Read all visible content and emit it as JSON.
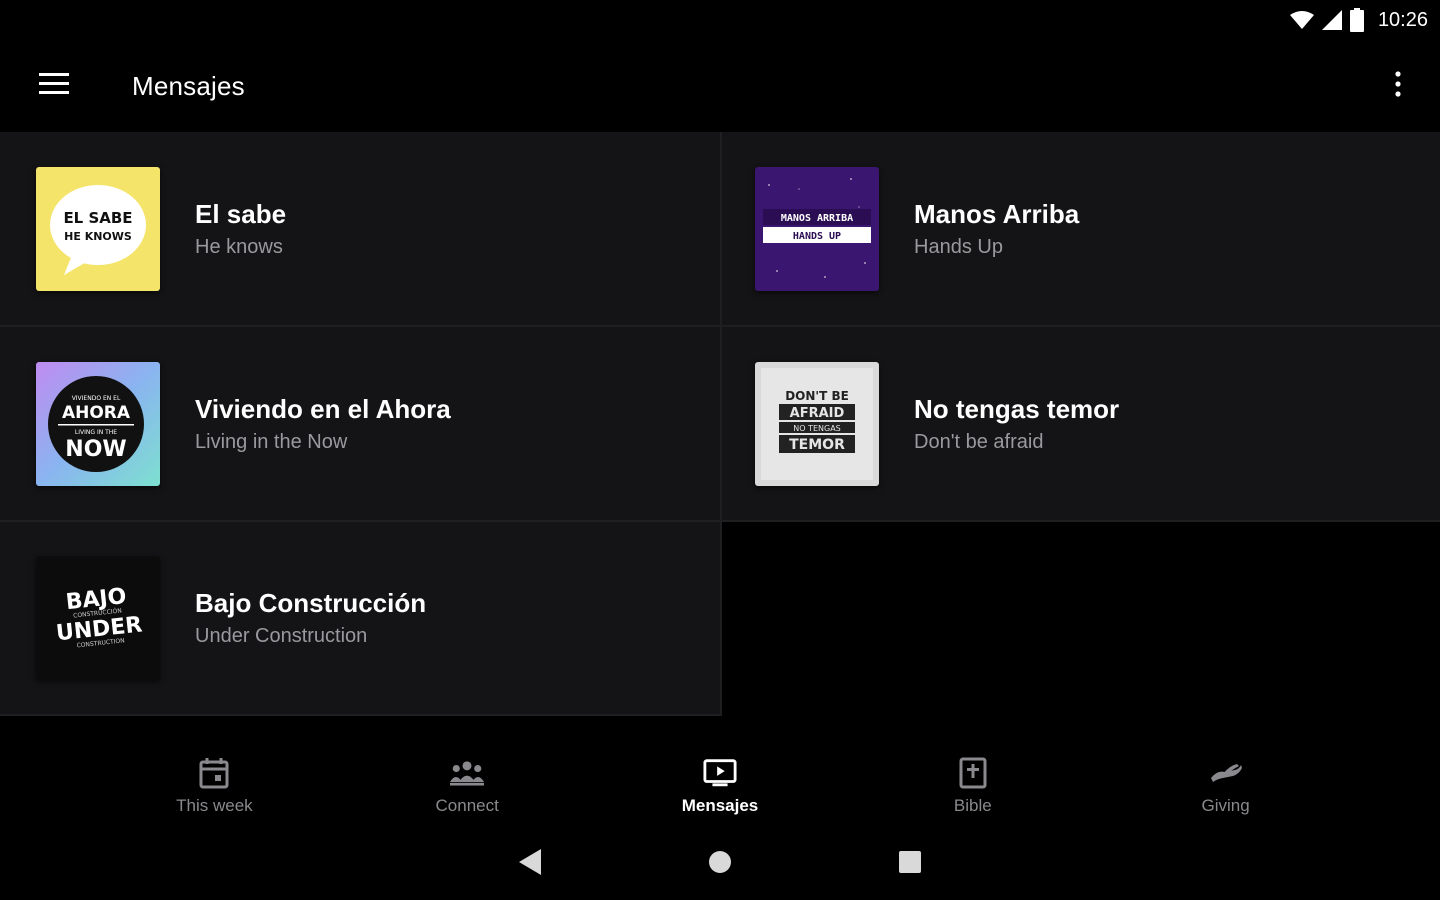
{
  "status_bar": {
    "time": "10:26",
    "icons": [
      "wifi-icon",
      "cell-signal-icon",
      "battery-icon"
    ]
  },
  "app_bar": {
    "title": "Mensajes",
    "menu_icon": "hamburger-menu-icon",
    "overflow_icon": "more-vert-icon"
  },
  "messages": [
    {
      "title": "El sabe",
      "subtitle": "He knows",
      "art": {
        "line1": "EL SABE",
        "line2": "HE KNOWS"
      }
    },
    {
      "title": "Manos Arriba",
      "subtitle": "Hands Up",
      "art": {
        "line1": "MANOS ARRIBA",
        "line2": "HANDS UP"
      }
    },
    {
      "title": "Viviendo en el Ahora",
      "subtitle": "Living in the Now",
      "art": {
        "line1": "VIVIENDO EN EL",
        "line2": "AHORA",
        "line3": "LIVING IN THE",
        "line4": "NOW"
      }
    },
    {
      "title": "No tengas temor",
      "subtitle": "Don't be afraid",
      "art": {
        "line1": "DON'T BE",
        "line2": "AFRAID",
        "line3": "NO TENGAS",
        "line4": "TEMOR"
      }
    },
    {
      "title": "Bajo Construcción",
      "subtitle": "Under Construction",
      "art": {
        "line1": "BAJO",
        "line2": "CONSTRUCCIÓN",
        "line3": "UNDER",
        "line4": "CONSTRUCTION"
      }
    }
  ],
  "bottom_nav": [
    {
      "label": "This week",
      "icon": "calendar-icon",
      "active": false
    },
    {
      "label": "Connect",
      "icon": "group-icon",
      "active": false
    },
    {
      "label": "Mensajes",
      "icon": "tv-play-icon",
      "active": true
    },
    {
      "label": "Bible",
      "icon": "bible-icon",
      "active": false
    },
    {
      "label": "Giving",
      "icon": "giving-hand-icon",
      "active": false
    }
  ],
  "colors": {
    "background": "#000000",
    "card": "#141416",
    "divider": "#1f1f22",
    "subtitle": "#9a9a9e",
    "inactive_nav": "#8a8a8e",
    "yellow_art": "#f4e46a",
    "purple_art": "#3a1670",
    "gray_art": "#d9d9d9"
  }
}
